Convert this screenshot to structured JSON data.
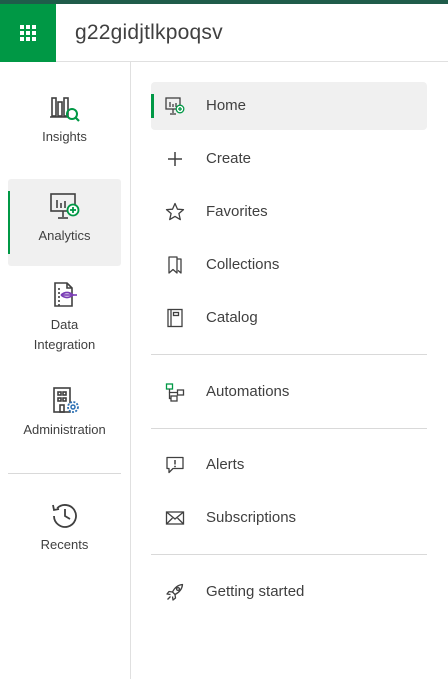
{
  "header": {
    "tenant_name": "g22gidjtlkpoqsv"
  },
  "sidebar": {
    "items": [
      {
        "label": "Insights"
      },
      {
        "label": "Analytics"
      },
      {
        "label": "Data\nIntegration"
      },
      {
        "label": "Administration"
      },
      {
        "label": "Recents"
      }
    ]
  },
  "menu": {
    "items": [
      {
        "label": "Home"
      },
      {
        "label": "Create"
      },
      {
        "label": "Favorites"
      },
      {
        "label": "Collections"
      },
      {
        "label": "Catalog"
      },
      {
        "label": "Automations"
      },
      {
        "label": "Alerts"
      },
      {
        "label": "Subscriptions"
      },
      {
        "label": "Getting started"
      }
    ]
  },
  "colors": {
    "brand": "#009845",
    "active_bg": "#f0f0f0",
    "text": "#404040",
    "border": "#e0e0e0"
  }
}
